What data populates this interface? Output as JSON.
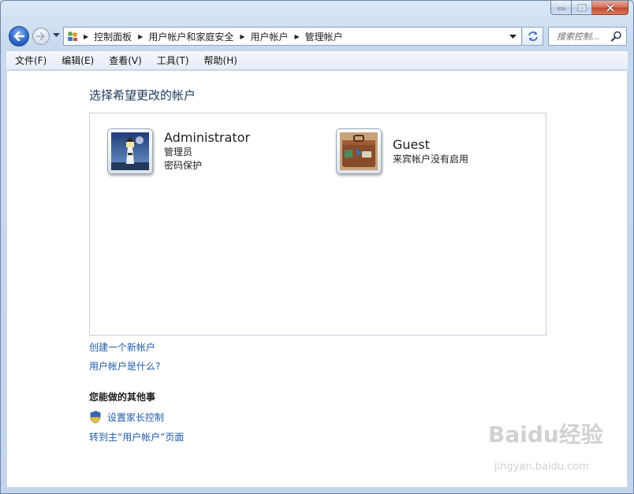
{
  "window": {
    "caption_buttons": [
      "minimize",
      "maximize",
      "close"
    ]
  },
  "nav": {
    "breadcrumbs": [
      "控制面板",
      "用户帐户和家庭安全",
      "用户帐户",
      "管理帐户"
    ],
    "search_placeholder": "搜索控制..."
  },
  "menu": {
    "items": [
      "文件(F)",
      "编辑(E)",
      "查看(V)",
      "工具(T)",
      "帮助(H)"
    ]
  },
  "main": {
    "heading": "选择希望更改的帐户",
    "accounts": [
      {
        "name": "Administrator",
        "lines": [
          "管理员",
          "密码保护"
        ],
        "icon": "lighthouse-icon"
      },
      {
        "name": "Guest",
        "lines": [
          "来宾帐户没有启用"
        ],
        "icon": "suitcase-icon"
      }
    ],
    "links": {
      "create": "创建一个新帐户",
      "what_is": "用户帐户是什么?"
    },
    "other": {
      "title": "您能做的其他事",
      "parental": "设置家长控制",
      "goto_main": "转到主“用户帐户”页面"
    }
  },
  "watermark": {
    "brand": "Baidu经验",
    "url": "jingyan.baidu.com"
  },
  "colors": {
    "link": "#1e5aa8",
    "heading": "#1e395b",
    "frame": "#c2d5ec"
  }
}
